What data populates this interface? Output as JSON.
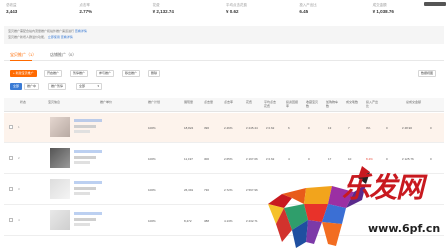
{
  "top_bar": {
    "indicator": ""
  },
  "stats": [
    {
      "label": "总收益",
      "value": "3,443"
    },
    {
      "label": "点击率",
      "value": "2.77%"
    },
    {
      "label": "花费",
      "value": "¥ 2,132.74"
    },
    {
      "label": "平均点击花费",
      "value": "¥ 0.62"
    },
    {
      "label": "投入产出比",
      "value": "6.45"
    },
    {
      "label": "成交金额",
      "value": "¥ 1,038.76"
    }
  ],
  "notice": {
    "line1": "宝贝推广需配合站内流量推广和站外推广渠道进行",
    "line1_link": "查看详情",
    "line2": "宝贝推广新增人群溢价功能，",
    "line2_link": "立即使用",
    "line2_link2": "查看详情"
  },
  "tabs": [
    {
      "label": "宝贝推广（1）",
      "active": true
    },
    {
      "label": "店铺推广（0）",
      "active": false
    }
  ],
  "actions": {
    "new": "+ 新建宝贝推广",
    "batch1": "开启推广",
    "batch2": "暂停推广",
    "batch3": "参与推广",
    "batch4": "移出推广",
    "batch5": "删除",
    "right": "数据视图"
  },
  "filters": {
    "all": "全部",
    "f1": "推广中",
    "f2": "推广暂停",
    "select_value": "全部"
  },
  "columns": [
    "状态",
    "宝贝信息",
    "推广单价",
    "推广计划",
    "展现量",
    "点击量",
    "点击率",
    "花费",
    "平均点击花费",
    "投资回报率",
    "收藏宝贝数",
    "加购物车数",
    "成交笔数",
    "投入产出比",
    "总成交金额"
  ],
  "rows": [
    {
      "idx": "1",
      "rate": "100%",
      "impr": "18,824",
      "clicks": "396",
      "ctr": "2.46%",
      "cost": "¥ 245.44",
      "cpc": "¥ 0.62",
      "r1": "6",
      "r2": "0",
      "r3": "13",
      "r4": "7",
      "r5": "0%",
      "r6": "0",
      "amt": "¥ 48.90",
      "r7": "0"
    },
    {
      "idx": "2",
      "rate": "100%",
      "impr": "11,197",
      "clicks": "300",
      "ctr": "2.65%",
      "cost": "¥ 197.06",
      "cpc": "¥ 0.62",
      "r1": "4",
      "r2": "0",
      "r3": "17",
      "r4": "10",
      "r5": "8.4%",
      "r6": "0",
      "amt": "¥ 125.76",
      "r7": "0"
    },
    {
      "idx": "3",
      "rate": "100%",
      "impr": "26,391",
      "clicks": "730",
      "ctr": "2.72%",
      "cost": "¥ 597.96",
      "cpc": "¥ 0.72",
      "r1": "5",
      "r2": "0",
      "r3": "11",
      "r4": "",
      "r5": "",
      "r6": "",
      "amt": "",
      "r7": ""
    },
    {
      "idx": "4",
      "rate": "100%",
      "impr": "8,472",
      "clicks": "388",
      "ctr": "4.13%",
      "cost": "¥ 232.71",
      "cpc": "¥ 0.68",
      "r1": "7",
      "r2": "0",
      "r3": "13",
      "r4": "5",
      "r5": "0.77%",
      "r6": "6.7",
      "amt": "",
      "r7": ""
    }
  ],
  "watermark": {
    "brand": "乐发网",
    "url": "www.6pf.cn"
  },
  "colors": {
    "accent": "#ff6a00",
    "link": "#3a7bd5",
    "brand_red": "#c8191f"
  }
}
